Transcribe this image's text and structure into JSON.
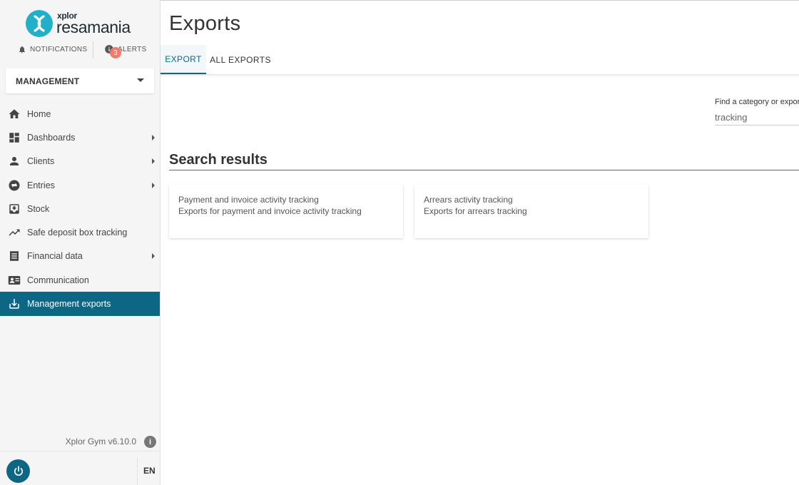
{
  "brand": {
    "small": "xplor",
    "big": "resamania"
  },
  "topbar": {
    "notifications_label": "NOTIFICATIONS",
    "alerts_label": "ALERTS",
    "alerts_count": "3"
  },
  "context_select": {
    "value": "MANAGEMENT"
  },
  "sidebar": {
    "items": [
      {
        "label": "Home",
        "icon": "home-icon",
        "has_submenu": false,
        "active": false
      },
      {
        "label": "Dashboards",
        "icon": "dashboard-icon",
        "has_submenu": true,
        "active": false
      },
      {
        "label": "Clients",
        "icon": "person-icon",
        "has_submenu": true,
        "active": false
      },
      {
        "label": "Entries",
        "icon": "swap-icon",
        "has_submenu": true,
        "active": false
      },
      {
        "label": "Stock",
        "icon": "inbox-icon",
        "has_submenu": false,
        "active": false
      },
      {
        "label": "Safe deposit box tracking",
        "icon": "trending-up-icon",
        "has_submenu": false,
        "active": false
      },
      {
        "label": "Financial data",
        "icon": "receipt-icon",
        "has_submenu": true,
        "active": false
      },
      {
        "label": "Communication",
        "icon": "contact-card-icon",
        "has_submenu": false,
        "active": false
      },
      {
        "label": "Management exports",
        "icon": "download-icon",
        "has_submenu": false,
        "active": true
      }
    ],
    "version": "Xplor Gym v6.10.0",
    "language": "EN"
  },
  "main": {
    "title": "Exports",
    "tabs": [
      {
        "label": "EXPORT",
        "active": true
      },
      {
        "label": "ALL EXPORTS",
        "active": false
      }
    ],
    "search": {
      "label": "Find a category or export",
      "value": "tracking"
    },
    "results_title": "Search results",
    "results": [
      {
        "title": "Payment and invoice activity tracking",
        "description": "Exports for payment and invoice activity tracking"
      },
      {
        "title": "Arrears activity tracking",
        "description": "Exports for arrears tracking"
      }
    ]
  },
  "colors": {
    "accent": "#0d6784",
    "brand": "#20b0c8",
    "badge": "#f07a6b",
    "sidebar_bg": "#f5f5f5"
  }
}
